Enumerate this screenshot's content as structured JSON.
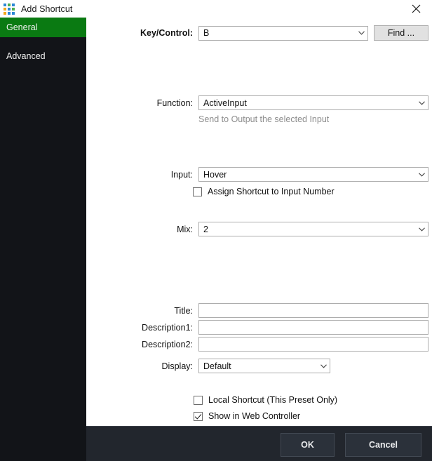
{
  "window": {
    "title": "Add Shortcut",
    "icon": "windows-grid-icon",
    "close_label": "✕",
    "icon_colors": [
      "#2b87d6",
      "#4caf50",
      "#2b87d6",
      "#f2a81d",
      "#2b87d6",
      "#4caf50",
      "#f2a81d",
      "#2b87d6",
      "#2b87d6"
    ]
  },
  "sidebar": {
    "items": [
      {
        "label": "General",
        "selected": true
      },
      {
        "label": "Advanced",
        "selected": false
      }
    ],
    "selected_color": "#0a7a12",
    "background": "#121418"
  },
  "form": {
    "key_control": {
      "label": "Key/Control:",
      "value": "B",
      "find_button": "Find ..."
    },
    "function": {
      "label": "Function:",
      "value": "ActiveInput",
      "hint": "Send to Output the selected Input"
    },
    "input": {
      "label": "Input:",
      "value": "Hover",
      "checkbox_label": "Assign Shortcut to Input Number",
      "checkbox_checked": false
    },
    "mix": {
      "label": "Mix:",
      "value": "2"
    },
    "title": {
      "label": "Title:",
      "value": "",
      "placeholder": ""
    },
    "description1": {
      "label": "Description1:",
      "value": "",
      "placeholder": ""
    },
    "description2": {
      "label": "Description2:",
      "value": "",
      "placeholder": ""
    },
    "display": {
      "label": "Display:",
      "value": "Default"
    },
    "local_shortcut": {
      "label": "Local Shortcut (This Preset Only)",
      "checked": false
    },
    "web_controller": {
      "label": "Show in Web Controller",
      "checked": true
    }
  },
  "footer": {
    "ok_label": "OK",
    "cancel_label": "Cancel",
    "background": "#22262d"
  }
}
